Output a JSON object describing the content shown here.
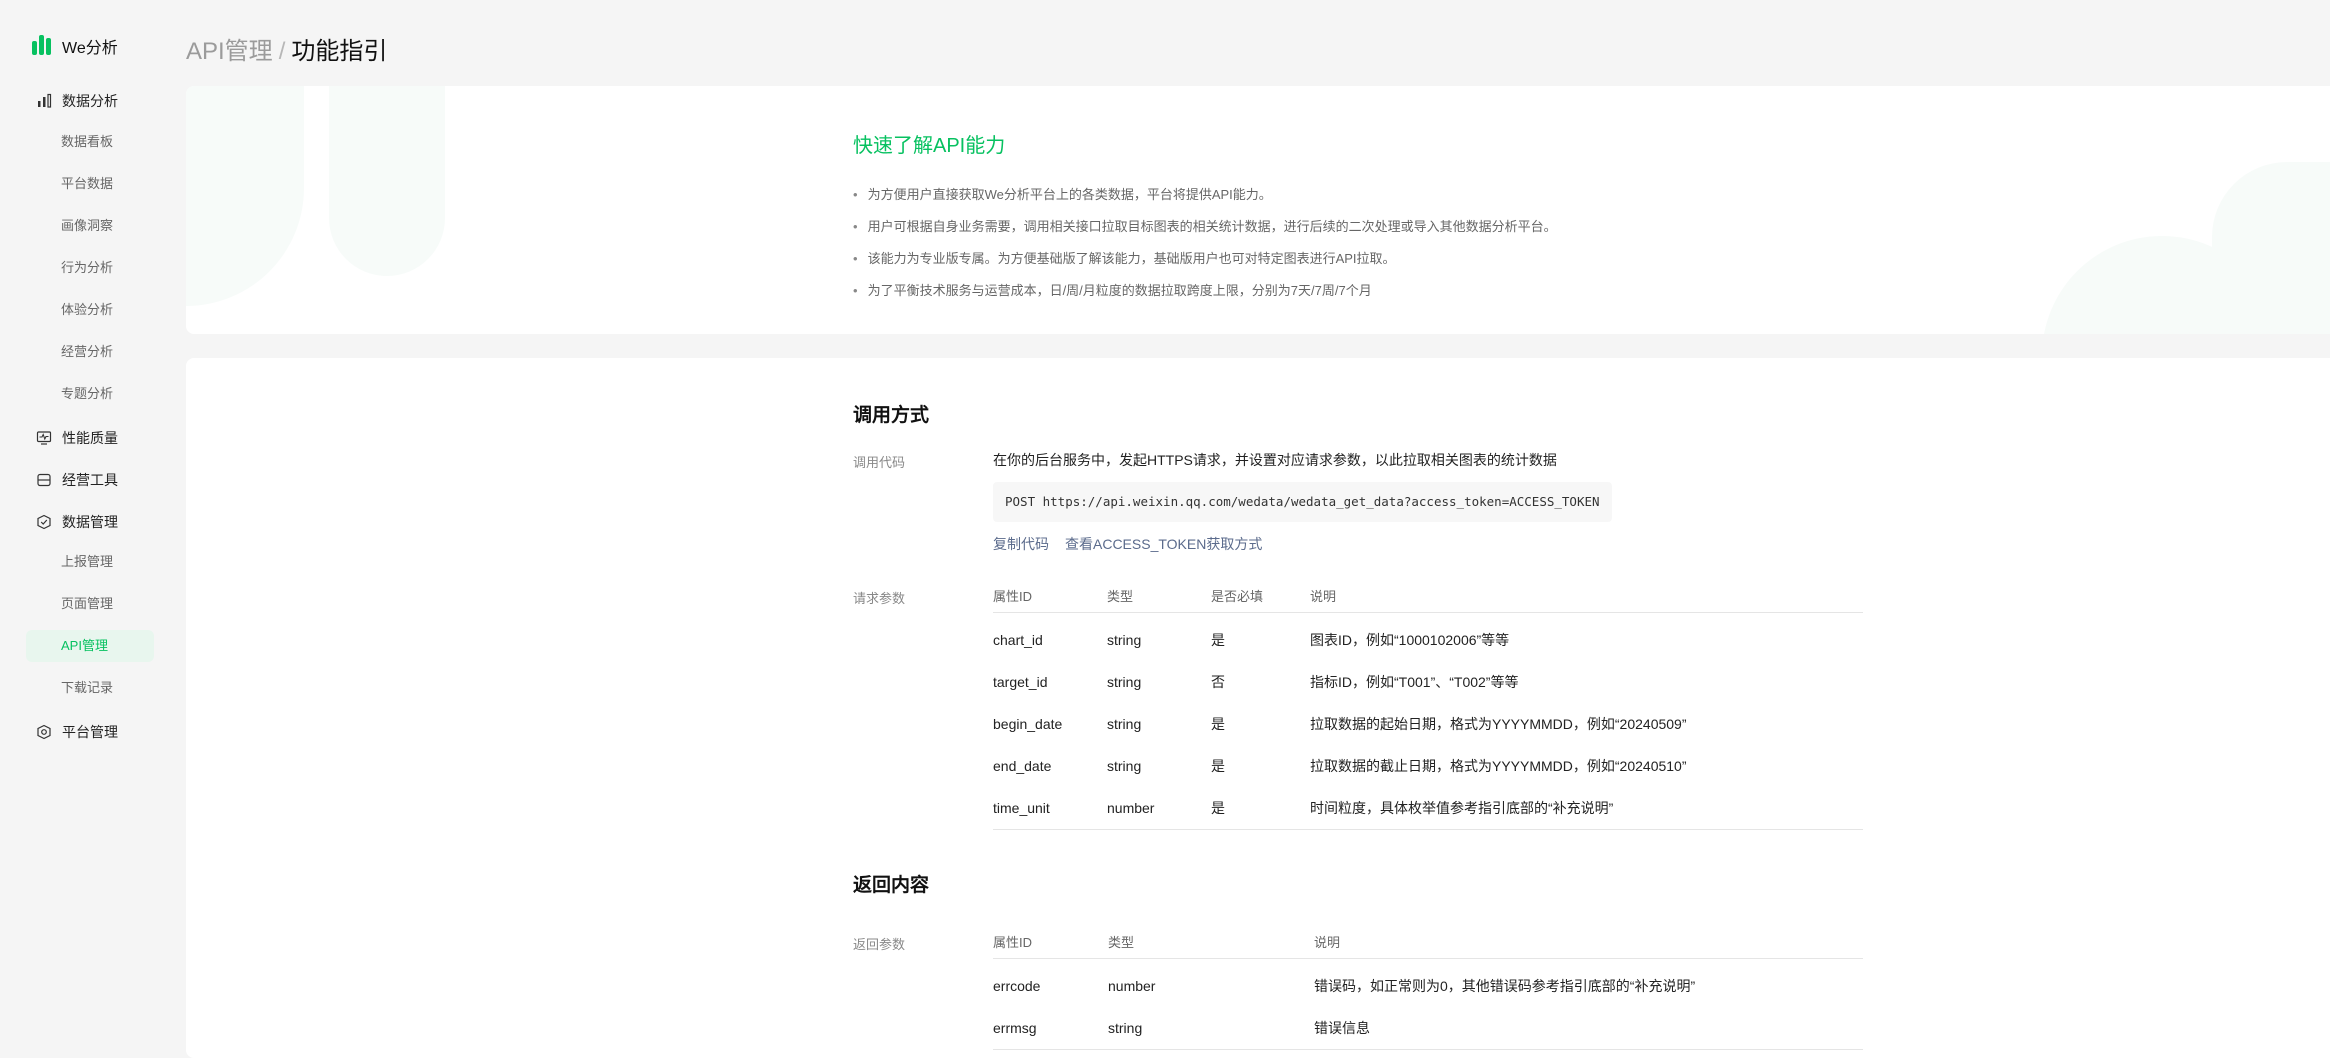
{
  "brand": {
    "name": "We分析",
    "accent": "#07c160"
  },
  "sidebar": {
    "groups": [
      {
        "label": "数据分析",
        "icon": "bar-chart-icon",
        "items": [
          "数据看板",
          "平台数据",
          "画像洞察",
          "行为分析",
          "体验分析",
          "经营分析",
          "专题分析"
        ]
      },
      {
        "label": "性能质量",
        "icon": "monitor-pulse-icon"
      },
      {
        "label": "经营工具",
        "icon": "toolbox-icon"
      },
      {
        "label": "数据管理",
        "icon": "database-shield-icon",
        "items": [
          "上报管理",
          "页面管理",
          "API管理",
          "下载记录"
        ],
        "active": "API管理"
      },
      {
        "label": "平台管理",
        "icon": "gear-hexagon-icon"
      }
    ]
  },
  "breadcrumb": {
    "parent": "API管理",
    "separator": "/",
    "current": "功能指引"
  },
  "intro": {
    "title": "快速了解API能力",
    "bullets": [
      "为方便用户直接获取We分析平台上的各类数据，平台将提供API能力。",
      "用户可根据自身业务需要，调用相关接口拉取目标图表的相关统计数据，进行后续的二次处理或导入其他数据分析平台。",
      "该能力为专业版专属。为方便基础版了解该能力，基础版用户也可对特定图表进行API拉取。",
      "为了平衡技术服务与运营成本，日/周/月粒度的数据拉取跨度上限，分别为7天/7周/7个月"
    ]
  },
  "call": {
    "title": "调用方式",
    "code_label": "调用代码",
    "description": "在你的后台服务中，发起HTTPS请求，并设置对应请求参数，以此拉取相关图表的统计数据",
    "code": "POST https://api.weixin.qq.com/wedata/wedata_get_data?access_token=ACCESS_TOKEN",
    "copy_link": "复制代码",
    "token_link": "查看ACCESS_TOKEN获取方式",
    "params_label": "请求参数",
    "headers": [
      "属性ID",
      "类型",
      "是否必填",
      "说明"
    ],
    "rows": [
      [
        "chart_id",
        "string",
        "是",
        "图表ID，例如“1000102006”等等"
      ],
      [
        "target_id",
        "string",
        "否",
        "指标ID，例如“T001”、“T002”等等"
      ],
      [
        "begin_date",
        "string",
        "是",
        "拉取数据的起始日期，格式为YYYYMMDD，例如“20240509”"
      ],
      [
        "end_date",
        "string",
        "是",
        "拉取数据的截止日期，格式为YYYYMMDD，例如“20240510”"
      ],
      [
        "time_unit",
        "number",
        "是",
        "时间粒度，具体枚举值参考指引底部的“补充说明”"
      ]
    ]
  },
  "response": {
    "title": "返回内容",
    "params_label": "返回参数",
    "headers": [
      "属性ID",
      "类型",
      "说明"
    ],
    "rows": [
      [
        "errcode",
        "number",
        "错误码，如正常则为0，其他错误码参考指引底部的“补充说明”"
      ],
      [
        "errmsg",
        "string",
        "错误信息"
      ]
    ]
  }
}
